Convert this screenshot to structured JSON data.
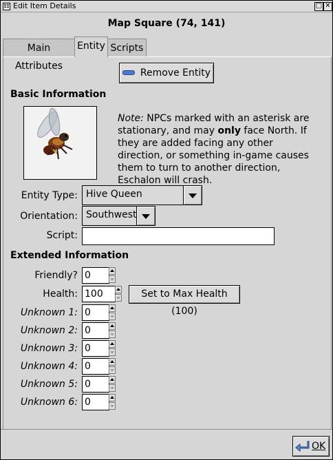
{
  "window": {
    "title": "Edit Item Details",
    "heading": "Map Square (74, 141)"
  },
  "tabs": [
    {
      "label": "Main Attributes",
      "active": false
    },
    {
      "label": "Entity",
      "active": true
    },
    {
      "label": "Scripts",
      "active": false
    }
  ],
  "actions": {
    "remove_entity": "Remove Entity",
    "ok": "OK"
  },
  "basic": {
    "title": "Basic Information",
    "note_lead": "Note:",
    "note_text1": " NPCs marked with an asterisk are stationary, and may ",
    "note_bold": "only",
    "note_text2": " face North.  If they are added facing any other direction, or something in-game causes them to turn to another direction, Eschalon will crash.",
    "entity_type_label": "Entity Type:",
    "entity_type_value": "Hive Queen",
    "orientation_label": "Orientation:",
    "orientation_value": "Southwest",
    "script_label": "Script:",
    "script_value": ""
  },
  "extended": {
    "title": "Extended Information",
    "friendly_label": "Friendly?",
    "friendly_value": "0",
    "health_label": "Health:",
    "health_value": "100",
    "max_health_button": "Set to Max Health (100)",
    "unknowns": [
      {
        "label": "Unknown 1:",
        "value": "0"
      },
      {
        "label": "Unknown 2:",
        "value": "0"
      },
      {
        "label": "Unknown 3:",
        "value": "0"
      },
      {
        "label": "Unknown 4:",
        "value": "0"
      },
      {
        "label": "Unknown 5:",
        "value": "0"
      },
      {
        "label": "Unknown 6:",
        "value": "0"
      }
    ]
  },
  "icons": [
    "app-menu-icon",
    "minimize-icon",
    "close-icon",
    "minus-icon",
    "ok-arrow-icon",
    "hive-queen-sprite"
  ]
}
